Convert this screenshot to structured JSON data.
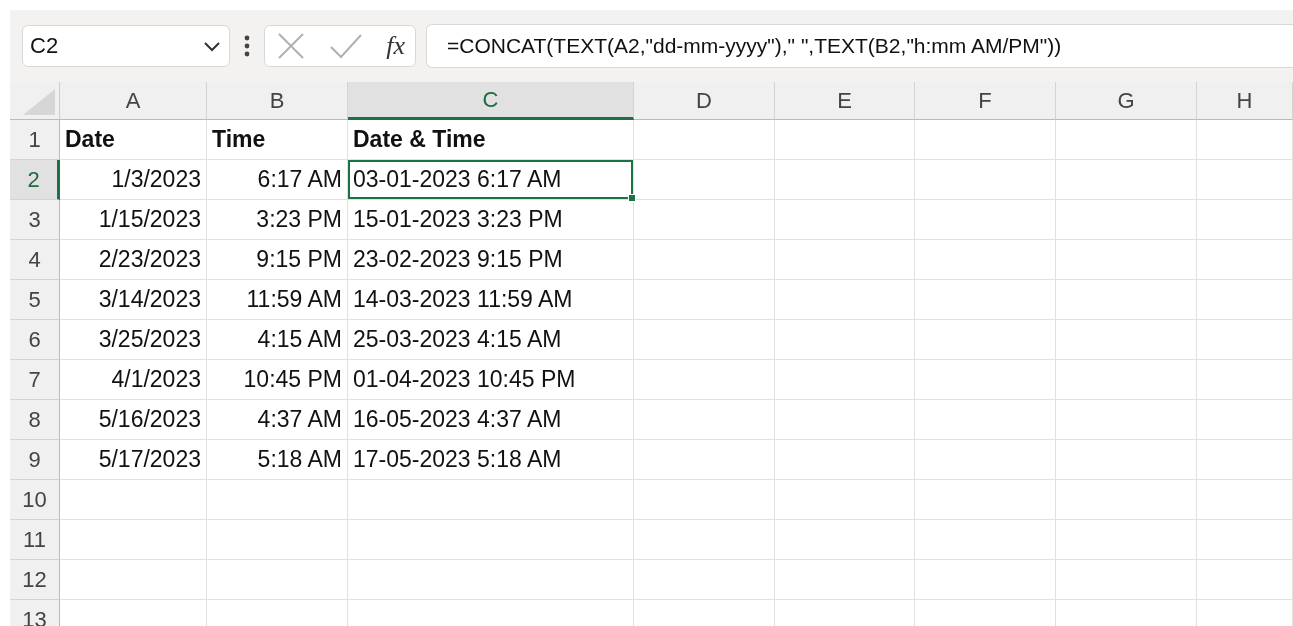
{
  "name_box": {
    "value": "C2"
  },
  "formula_bar": {
    "function_label": "fx",
    "value": "=CONCAT(TEXT(A2,\"dd-mm-yyyy\"),\" \",TEXT(B2,\"h:mm AM/PM\"))"
  },
  "columns": [
    {
      "label": "A",
      "selected": false
    },
    {
      "label": "B",
      "selected": false
    },
    {
      "label": "C",
      "selected": true
    },
    {
      "label": "D",
      "selected": false
    },
    {
      "label": "E",
      "selected": false
    },
    {
      "label": "F",
      "selected": false
    },
    {
      "label": "G",
      "selected": false
    },
    {
      "label": "H",
      "selected": false
    }
  ],
  "rows": [
    {
      "label": "1",
      "selected": false,
      "kind": "header",
      "cells": [
        "Date",
        "Time",
        "Date & Time"
      ]
    },
    {
      "label": "2",
      "selected": true,
      "kind": "data",
      "cells": [
        "1/3/2023",
        "6:17 AM",
        "03-01-2023 6:17 AM"
      ]
    },
    {
      "label": "3",
      "selected": false,
      "kind": "data",
      "cells": [
        "1/15/2023",
        "3:23 PM",
        "15-01-2023 3:23 PM"
      ]
    },
    {
      "label": "4",
      "selected": false,
      "kind": "data",
      "cells": [
        "2/23/2023",
        "9:15 PM",
        "23-02-2023 9:15 PM"
      ]
    },
    {
      "label": "5",
      "selected": false,
      "kind": "data",
      "cells": [
        "3/14/2023",
        "11:59 AM",
        "14-03-2023 11:59 AM"
      ]
    },
    {
      "label": "6",
      "selected": false,
      "kind": "data",
      "cells": [
        "3/25/2023",
        "4:15 AM",
        "25-03-2023 4:15 AM"
      ]
    },
    {
      "label": "7",
      "selected": false,
      "kind": "data",
      "cells": [
        "4/1/2023",
        "10:45 PM",
        "01-04-2023 10:45 PM"
      ]
    },
    {
      "label": "8",
      "selected": false,
      "kind": "data",
      "cells": [
        "5/16/2023",
        "4:37 AM",
        "16-05-2023 4:37 AM"
      ]
    },
    {
      "label": "9",
      "selected": false,
      "kind": "data",
      "cells": [
        "5/17/2023",
        "5:18 AM",
        "17-05-2023 5:18 AM"
      ]
    },
    {
      "label": "10",
      "selected": false
    },
    {
      "label": "11",
      "selected": false
    },
    {
      "label": "12",
      "selected": false
    },
    {
      "label": "13",
      "selected": false
    }
  ]
}
